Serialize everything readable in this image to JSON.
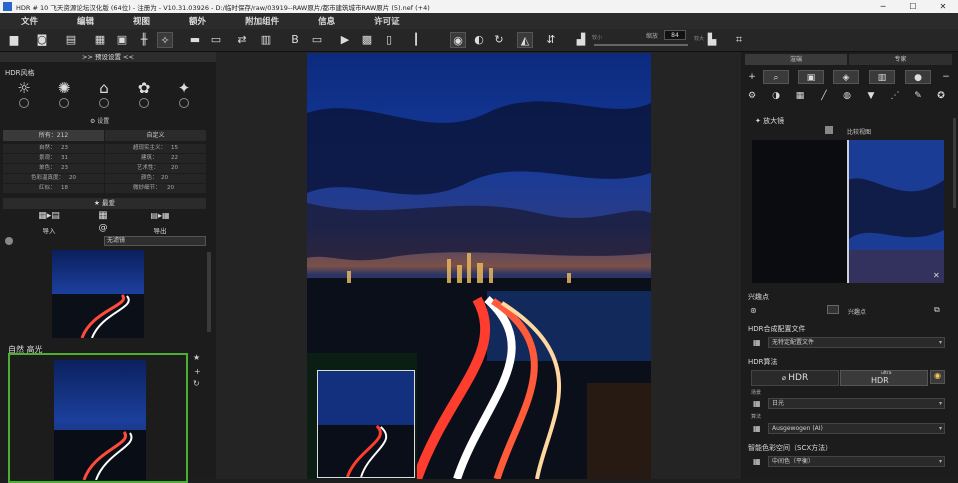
{
  "window": {
    "title": "HDR # 10 飞天资源论坛汉化版 (64位) - 注册为 - V10.31.03926 - D:/临时保存/raw/03919--RAW原片/都市建筑城市RAW原片 (5).nef (+4)"
  },
  "menu": [
    "文件",
    "编辑",
    "视图",
    "额外",
    "附加组件",
    "信息",
    "许可证"
  ],
  "toolbar": {
    "zoom_label": "缩放",
    "zoom_value": "84",
    "zoom_min": "较小",
    "zoom_max": "较大"
  },
  "left_panel": {
    "header": ">> 预设设置 <<",
    "style_title": "HDR风格",
    "settings_label": "设置",
    "tabs": {
      "all": "所有：212",
      "custom": "自定义"
    },
    "counts": [
      {
        "label": "自然：",
        "value": "23"
      },
      {
        "label": "超现实主义：",
        "value": "15"
      },
      {
        "label": "景观：",
        "value": "31"
      },
      {
        "label": "建筑：",
        "value": "22"
      },
      {
        "label": "单色：",
        "value": "23"
      },
      {
        "label": "艺术性：",
        "value": "20"
      },
      {
        "label": "色彩温真度：",
        "value": "20"
      },
      {
        "label": "颜色：",
        "value": "20"
      },
      {
        "label": "红似：",
        "value": "18"
      },
      {
        "label": "微妙细节：",
        "value": "20"
      }
    ],
    "favorites": "★ 最爱",
    "import": "导入",
    "export": "导出",
    "filter": "无滤镜",
    "thumb_label": "自然 高光"
  },
  "right_panel": {
    "tabs": [
      "渲端",
      "专家"
    ],
    "magnifier": "放大镜",
    "compare": "比较视图",
    "interest_title": "兴趣点",
    "interest_value": "兴趣点",
    "hdr_profile_title": "HDR合成配置文件",
    "hdr_profile_value": "无特定配置文件",
    "hdr_algo_title": "HDR算法",
    "hdr_button": "HDR",
    "ultra_hdr_small": "ultra",
    "ultra_hdr_button": "HDR",
    "scene_label": "场景",
    "scene_value": "日光",
    "algo_label": "算法",
    "algo_value": "Ausgewogen (AI)",
    "color_space_title": "智能色彩空间（SCX方法）",
    "color_space_value": "中间色（平衡）"
  }
}
